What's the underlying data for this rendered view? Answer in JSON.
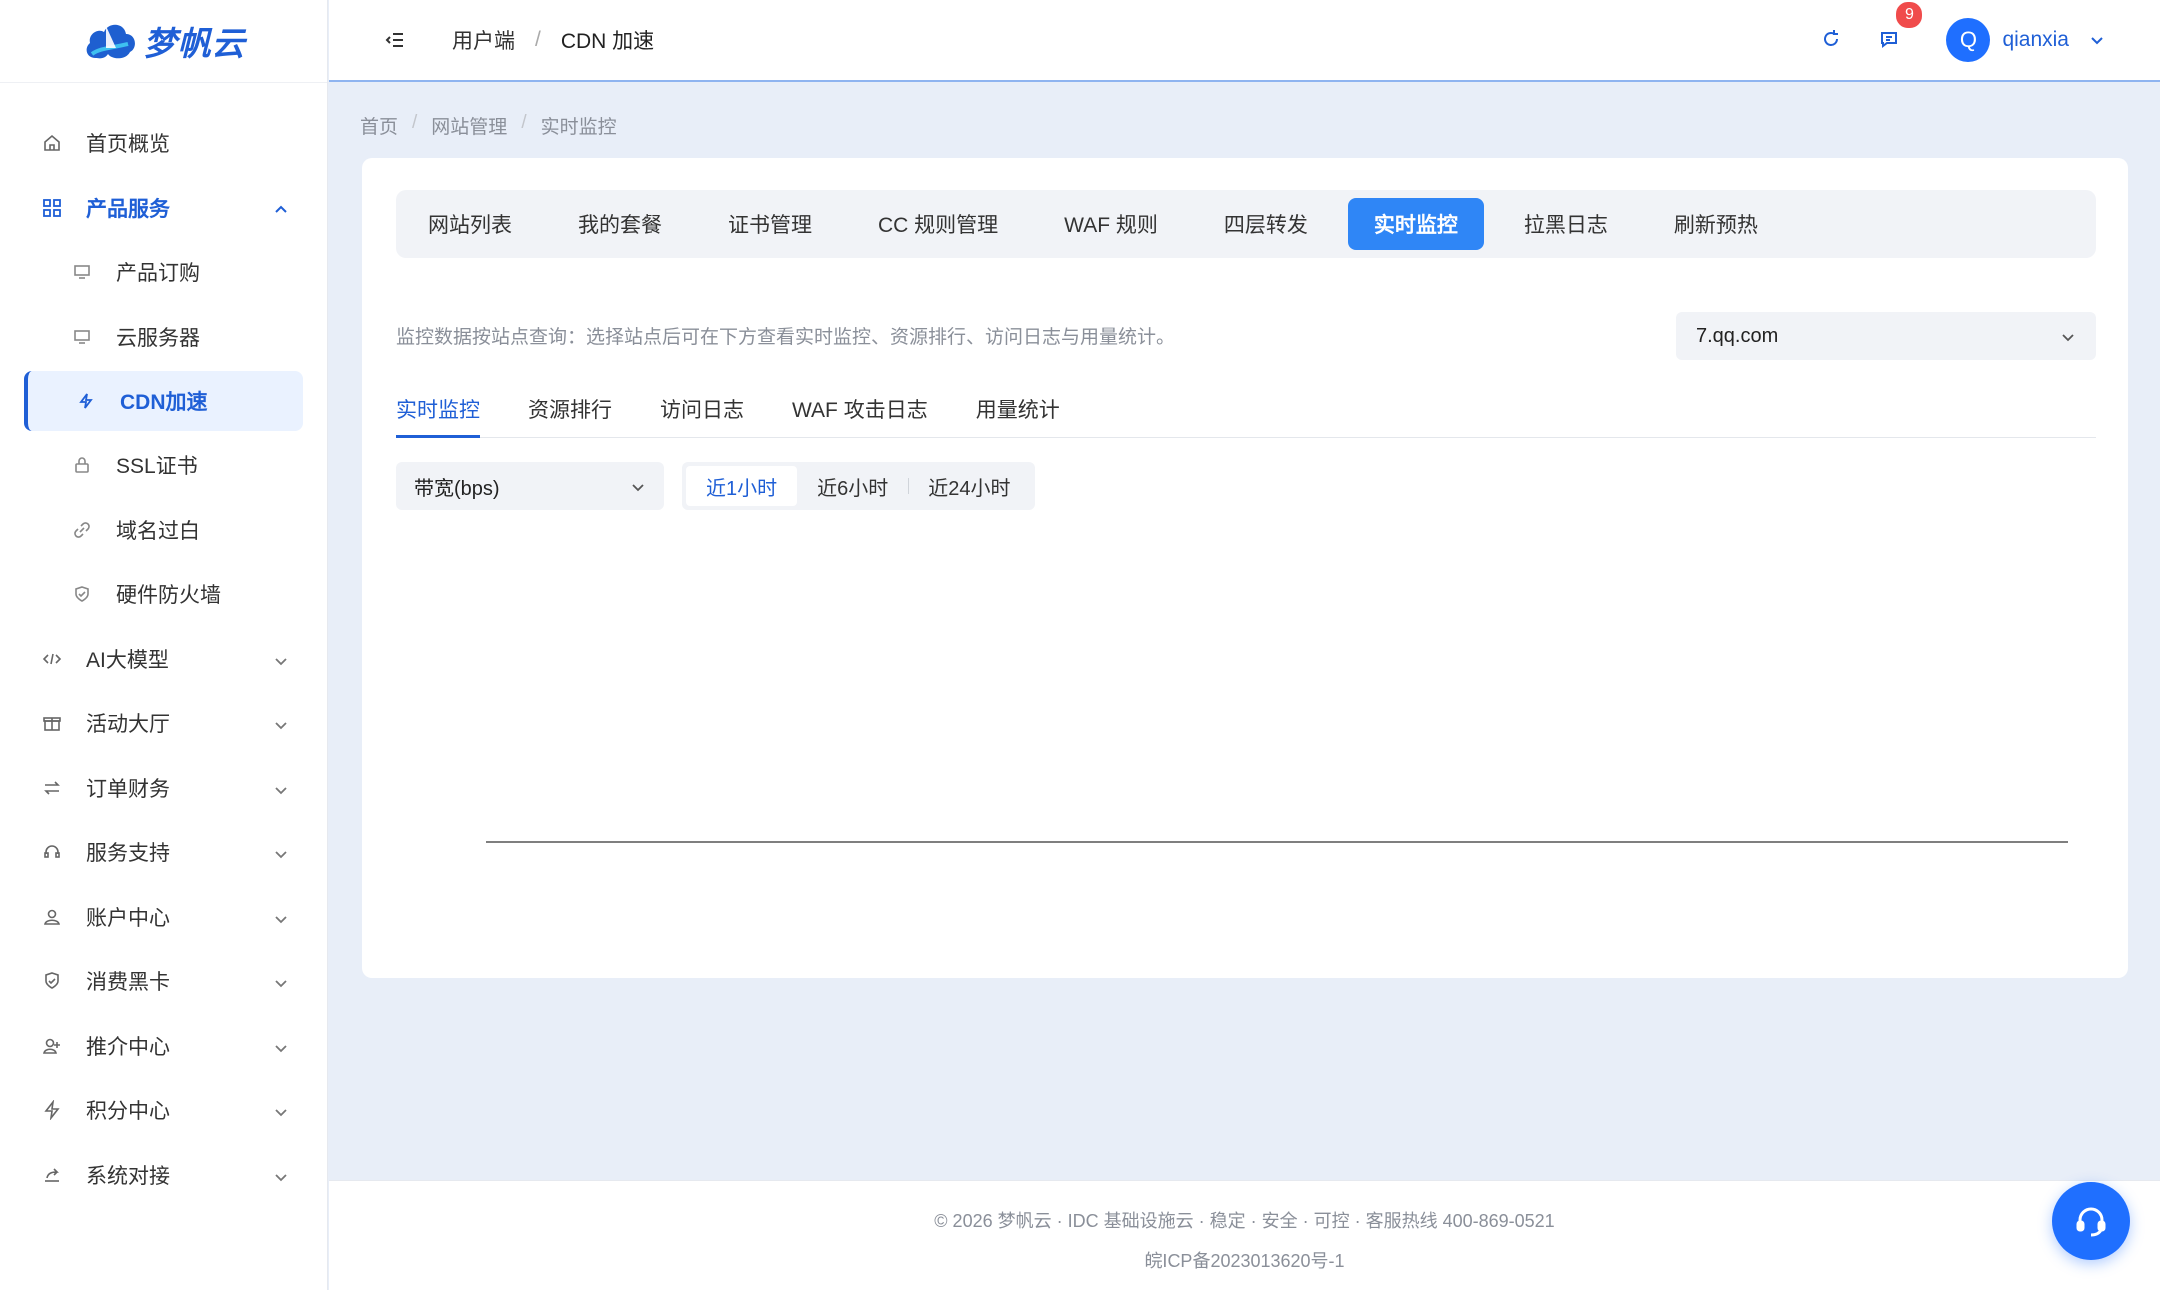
{
  "brand": {
    "name": "梦帆云"
  },
  "sidebar": {
    "home": "首页概览",
    "product_group": "产品服务",
    "product_items": [
      "产品订购",
      "云服务器",
      "CDN加速",
      "SSL证书",
      "域名过白",
      "硬件防火墙"
    ],
    "groups": [
      "AI大模型",
      "活动大厅",
      "订单财务",
      "服务支持",
      "账户中心",
      "消费黑卡",
      "推介中心",
      "积分中心",
      "系统对接"
    ]
  },
  "header": {
    "crumb_root": "用户端",
    "crumb_sep": "/",
    "crumb_current": "CDN 加速",
    "notification_count": "9",
    "avatar_letter": "Q",
    "username": "qianxia"
  },
  "breadcrumb": {
    "items": [
      "首页",
      "网站管理",
      "实时监控"
    ],
    "sep": "/"
  },
  "tabs": [
    "网站列表",
    "我的套餐",
    "证书管理",
    "CC 规则管理",
    "WAF 规则",
    "四层转发",
    "实时监控",
    "拉黑日志",
    "刷新预热"
  ],
  "active_tab": "实时监控",
  "hint": "监控数据按站点查询：选择站点后可在下方查看实时监控、资源排行、访问日志与用量统计。",
  "site_select": {
    "value": "7.qq.com"
  },
  "subtabs": [
    "实时监控",
    "资源排行",
    "访问日志",
    "WAF 攻击日志",
    "用量统计"
  ],
  "metric_select": {
    "value": "带宽(bps)"
  },
  "ranges": [
    "近1小时",
    "近6小时",
    "近24小时"
  ],
  "footer": {
    "line1": "© 2026 梦帆云 · IDC 基础设施云 · 稳定 · 安全 · 可控 · 客服热线 400-869-0521",
    "line2": "皖ICP备2023013620号-1"
  },
  "colors": {
    "accent": "#1f5fd6",
    "tab_active": "#2f86f6",
    "badge": "#f04b4b"
  }
}
